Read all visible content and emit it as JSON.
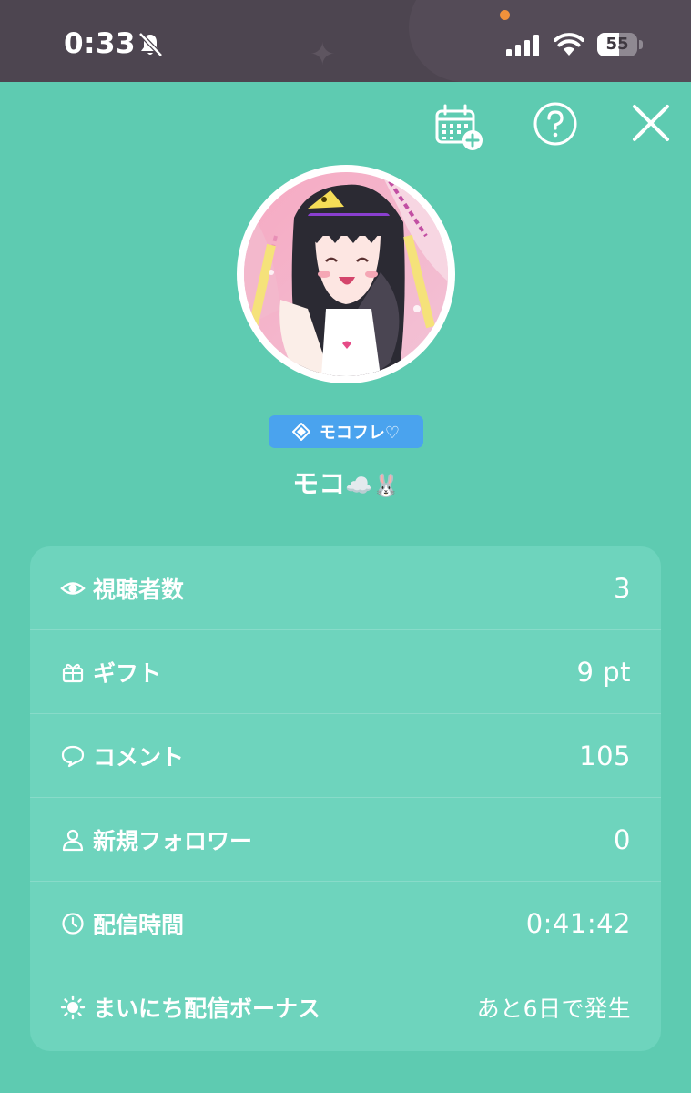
{
  "status_bar": {
    "time": "0:33",
    "battery": "55",
    "battery_level": 0.55,
    "icons": [
      "bell-off-icon",
      "signal-icon",
      "wifi-icon",
      "battery-icon"
    ]
  },
  "toolbar": {
    "icons": [
      "calendar-add-icon",
      "help-icon",
      "close-icon"
    ]
  },
  "profile": {
    "badge_label": "モコフレ♡",
    "username": "モコ",
    "username_emoji": "☁️🐰"
  },
  "stats": [
    {
      "icon": "eye-icon",
      "label": "視聴者数",
      "value": "3"
    },
    {
      "icon": "gift-icon",
      "label": "ギフト",
      "value": "9 pt"
    },
    {
      "icon": "comment-icon",
      "label": "コメント",
      "value": "105"
    },
    {
      "icon": "user-icon",
      "label": "新規フォロワー",
      "value": "0"
    },
    {
      "icon": "clock-icon",
      "label": "配信時間",
      "value": "0:41:42"
    },
    {
      "icon": "sun-icon",
      "label": "まいにち配信ボーナス",
      "value": "あと6日で発生"
    }
  ],
  "colors": {
    "background": "#5ecbb1",
    "card": "#6ed4bd",
    "status_bar": "#4d4550",
    "badge": "#4aa3ee",
    "text": "#ffffff"
  }
}
